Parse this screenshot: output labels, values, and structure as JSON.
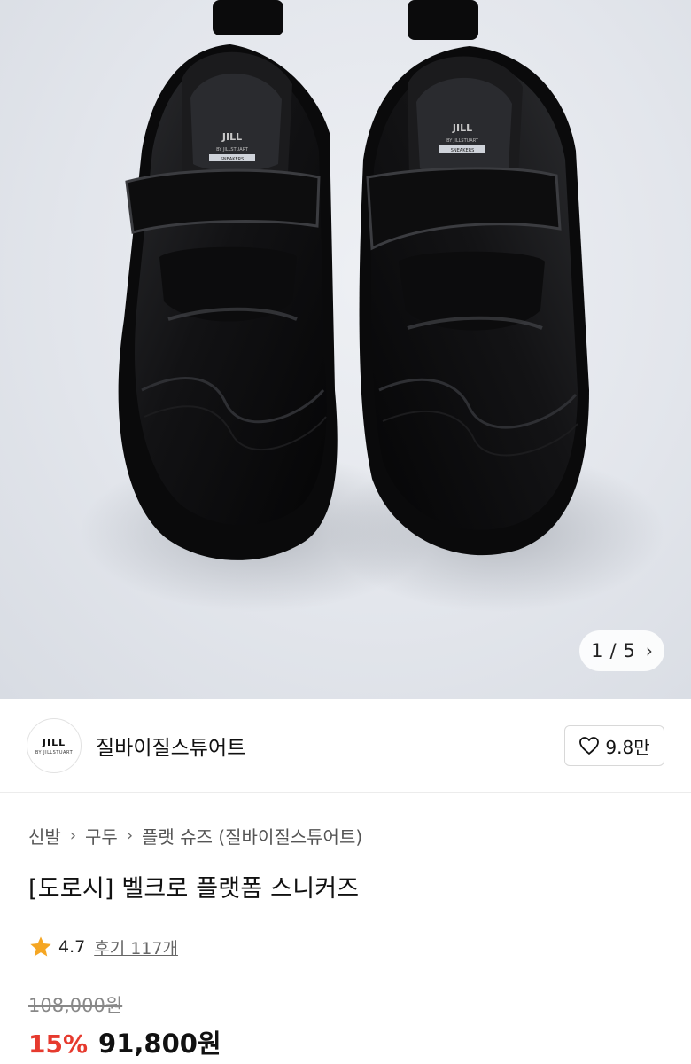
{
  "gallery": {
    "current": "1",
    "separator": "/",
    "total": "5",
    "next_icon": "chevron-right-icon",
    "shoe_label_brand": "JILL",
    "shoe_label_sub": "BY JILLSTUART",
    "shoe_label_tag": "SNEAKERS"
  },
  "brand": {
    "logo_main": "JILL",
    "logo_sub": "BY JILLSTUART",
    "name": "질바이질스튜어트",
    "likes": "9.8만",
    "like_icon": "heart-outline-icon"
  },
  "breadcrumb": {
    "items": [
      "신발",
      "구두",
      "플랫 슈즈 (질바이질스튜어트)"
    ],
    "separator_icon": "chevron-right-icon"
  },
  "product": {
    "title": "[도로시] 벨크로 플랫폼 스니커즈",
    "rating": "4.7",
    "rating_icon": "star-icon",
    "reviews": "후기 117개",
    "original_price": "108,000원",
    "discount": "15%",
    "sale_price": "91,800원"
  },
  "colors": {
    "discount": "#e63a2e",
    "star": "#f5a623"
  }
}
